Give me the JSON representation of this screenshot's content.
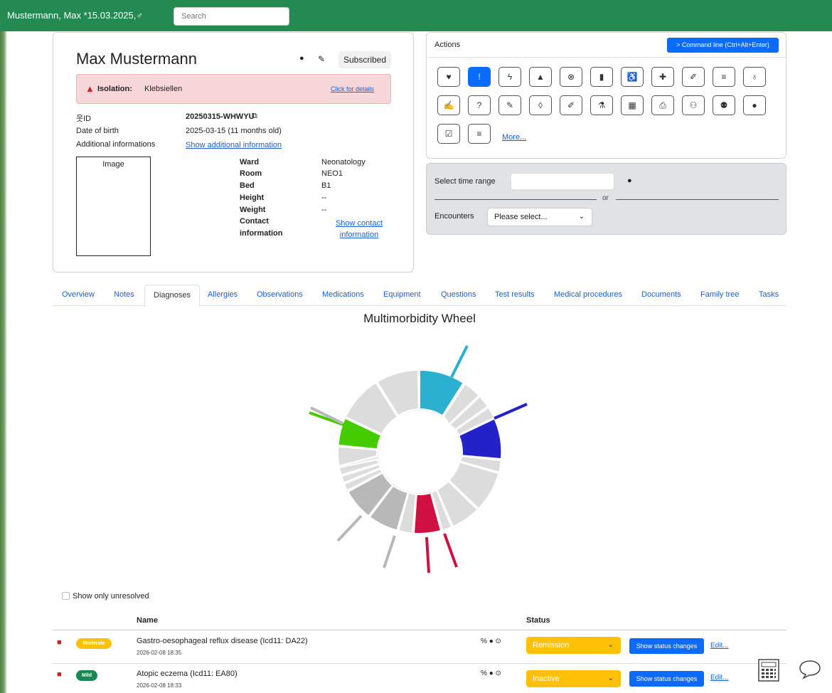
{
  "header": {
    "patient_label": "Mustermann, Max *15.03.2025,♂",
    "search_placeholder": "Search"
  },
  "patient": {
    "name": "Max Mustermann",
    "subscribed_label": "Subscribed",
    "isolation_label": "Isolation:",
    "isolation_value": "Klebsiellen",
    "isolation_link": "Click for details",
    "id_label": "웃ID",
    "id_value": "20250315-WHWYU",
    "dob_label": "Date of birth",
    "dob_value": "2025-03-15 (11 months old)",
    "addinfo_label": "Additional informations",
    "addinfo_link": "Show additional information",
    "image_label": "Image",
    "ward_label": "Ward",
    "ward_value": "Neonatology",
    "room_label": "Room",
    "room_value": "NEO1",
    "bed_label": "Bed",
    "bed_value": "B1",
    "height_label": "Height",
    "height_value": "--",
    "weight_label": "Weight",
    "weight_value": "--",
    "contact_label_1": "Contact",
    "contact_label_2": "information",
    "contact_link_1": "Show contact",
    "contact_link_2": "information"
  },
  "actions": {
    "title": "Actions",
    "command_button": "> Command line (Ctrl+Alt+Enter)",
    "more_link": "More..."
  },
  "time": {
    "select_label": "Select time range",
    "or_text": "or",
    "encounters_label": "Encounters",
    "encounters_value": "Please select..."
  },
  "tabs": [
    "Overview",
    "Notes",
    "Diagnoses",
    "Allergies",
    "Observations",
    "Medications",
    "Equipment",
    "Questions",
    "Test results",
    "Medical procedures",
    "Documents",
    "Family tree",
    "Tasks"
  ],
  "active_tab": "Diagnoses",
  "wheel": {
    "title": "Multimorbidity Wheel",
    "colors": {
      "cyan": "#2bb0cf",
      "blue": "#2222c8",
      "red": "#d01040",
      "green": "#44cc00",
      "grey_light": "#dcdcdc",
      "grey_mid": "#b8b8b8"
    }
  },
  "diagnoses": {
    "show_unresolved_label": "Show only unresolved",
    "col_name": "Name",
    "col_status": "Status",
    "rows": [
      {
        "severity": "Moderate",
        "severity_color": "#ffc107",
        "name": "Gastro-oesophageal reflux disease (Icd11: DA22)",
        "date": "2026-02-08 18:35",
        "status": "Remission",
        "status_btn": "Show status changes",
        "edit": "Edit..."
      },
      {
        "severity": "Mild",
        "severity_color": "#198754",
        "name": "Atopic eczema (Icd11: EA80)",
        "date": "2026-02-08 18:33",
        "status": "Inactive",
        "status_btn": "Show status changes",
        "edit": "Edit..."
      }
    ]
  }
}
